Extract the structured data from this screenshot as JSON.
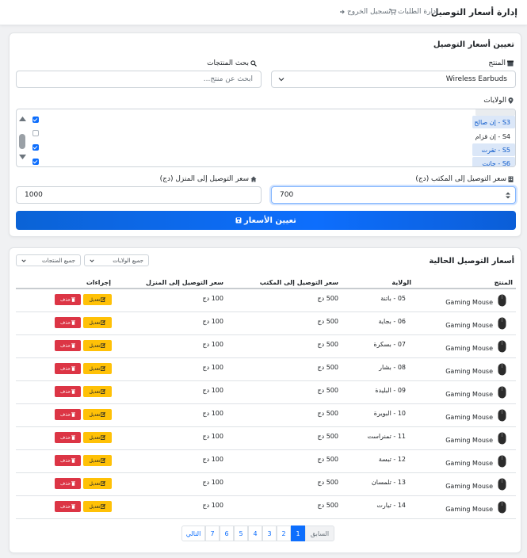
{
  "navbar": {
    "brand": "إدارة أسعار التوصيل",
    "orders_link": "إدارة الطلبات",
    "logout_link": "تسجيل الخروج"
  },
  "assign_card": {
    "title": "تعيين أسعار التوصيل",
    "product_label": "المنتج",
    "product_value": "Wireless Earbuds",
    "search_label": "بحث المنتجات",
    "search_placeholder": "ابحث عن منتج...",
    "states_label": "الولايات",
    "state_options": [
      {
        "label": "S3 - إن صالح",
        "selected": true
      },
      {
        "label": "S4 - إن قزام",
        "selected": false
      },
      {
        "label": "S5 - تقرت",
        "selected": true
      },
      {
        "label": "S6 - جانت",
        "selected": true
      }
    ],
    "office_price_label": "سعر التوصيل إلى المكتب (دج)",
    "office_price_value": "700",
    "home_price_label": "سعر التوصيل إلى المنزل (دج)",
    "home_price_value": "1000",
    "submit_label": "تعيين الأسعار"
  },
  "current_card": {
    "title": "أسعار التوصيل الحالية",
    "filter_states": "جميع الولايات",
    "filter_products": "جميع المنتجات",
    "columns": [
      "المنتج",
      "الولاية",
      "سعر التوصيل إلى المكتب",
      "سعر التوصيل إلى المنزل",
      "إجراءات"
    ],
    "edit_label": "تعديل",
    "delete_label": "حذف",
    "rows": [
      {
        "product": "Gaming Mouse",
        "state": "05 - باتنة",
        "office": "500 دج",
        "home": "100 دج"
      },
      {
        "product": "Gaming Mouse",
        "state": "06 - بجاية",
        "office": "500 دج",
        "home": "100 دج"
      },
      {
        "product": "Gaming Mouse",
        "state": "07 - بسكرة",
        "office": "500 دج",
        "home": "100 دج"
      },
      {
        "product": "Gaming Mouse",
        "state": "08 - بشار",
        "office": "500 دج",
        "home": "100 دج"
      },
      {
        "product": "Gaming Mouse",
        "state": "09 - البليدة",
        "office": "500 دج",
        "home": "100 دج"
      },
      {
        "product": "Gaming Mouse",
        "state": "10 - البويرة",
        "office": "500 دج",
        "home": "100 دج"
      },
      {
        "product": "Gaming Mouse",
        "state": "11 - تمنراست",
        "office": "500 دج",
        "home": "100 دج"
      },
      {
        "product": "Gaming Mouse",
        "state": "12 - تبسة",
        "office": "500 دج",
        "home": "100 دج"
      },
      {
        "product": "Gaming Mouse",
        "state": "13 - تلمسان",
        "office": "500 دج",
        "home": "100 دج"
      },
      {
        "product": "Gaming Mouse",
        "state": "14 - تيارت",
        "office": "500 دج",
        "home": "100 دج"
      }
    ],
    "pagination": {
      "prev": "السابق",
      "pages": [
        "1",
        "2",
        "3",
        "4",
        "5",
        "6",
        "7"
      ],
      "active_page": "1",
      "next": "التالي"
    }
  },
  "colors": {
    "primary": "#0d6efd",
    "warning": "#ffc107",
    "danger": "#dc3545"
  }
}
